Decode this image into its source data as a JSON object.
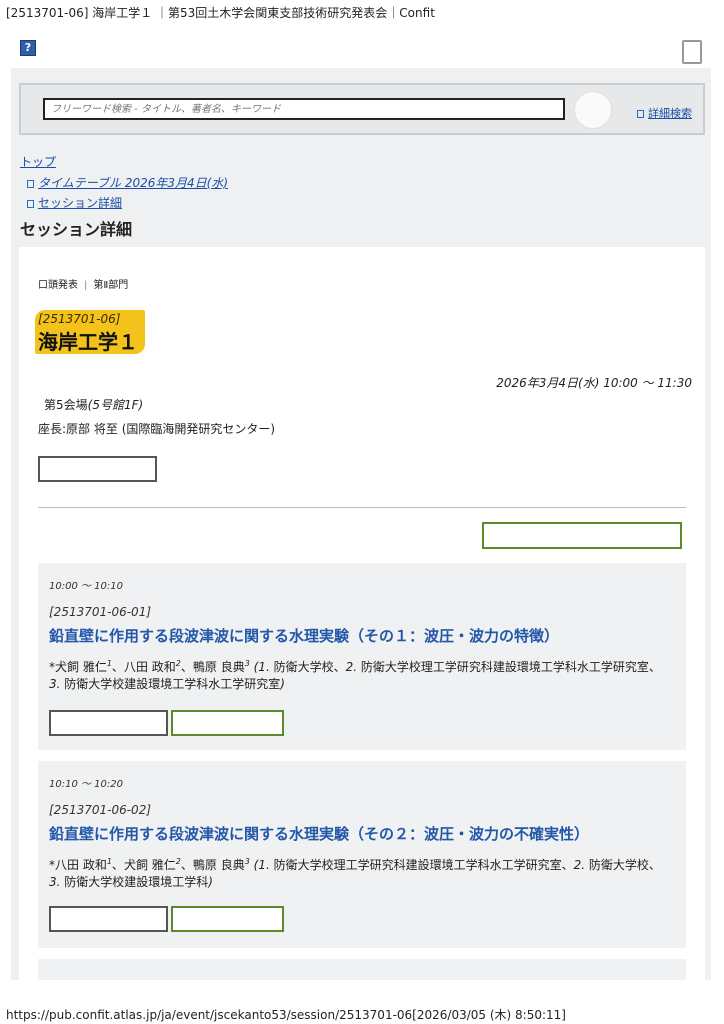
{
  "print_header": "[2513701-06] 海岸工学１ ｜第53回土木学会関東支部技術研究発表会｜Confit",
  "print_footer": "https://pub.confit.atlas.jp/ja/event/jscekanto53/session/2513701-06[2026/03/05 (木) 8:50:11]",
  "help_icon_label": "?",
  "search": {
    "placeholder": "フリーワード検索 - タイトル、著者名、キーワード",
    "advanced_label": "詳細検索"
  },
  "breadcrumb": {
    "top": "トップ",
    "timetable": "タイムテーブル 2026年3月4日(水)",
    "session": "セッション詳細"
  },
  "page_title": "セッション詳細",
  "session": {
    "type": "口頭発表",
    "division": "第Ⅱ部門",
    "id": "[2513701-06]",
    "title": "海岸工学１",
    "datetime": "2026年3月4日(水) 10:00 〜 11:30",
    "venue_room": "第5会場",
    "venue_building": "(5号館1F)",
    "chair_label": "座長:",
    "chair_name": "原部 将至",
    "chair_affil": "(国際臨海開発研究センター)"
  },
  "papers": [
    {
      "time": "10:00 〜 10:10",
      "id": "[2513701-06-01]",
      "title": "鉛直壁に作用する段波津波に関する水理実験（その１：波圧・波力の特徴）",
      "authors_line": "*犬飼 雅仁1、八田 政和2、鴨原 良典3",
      "a1": "*犬飼 雅仁",
      "s1": "1",
      "a2": "八田 政和",
      "s2": "2",
      "a3": "鴨原 良典",
      "s3": "3",
      "affil1_num": "(1.",
      "affil1": "防衛大学校、",
      "affil2_num": "2.",
      "affil2": "防衛大学校理工学研究科建設環境工学科水工学研究室、",
      "affil3_num": "3.",
      "affil3": "防衛大学校建設環境工学科水工学研究室",
      "affil_close": ")"
    },
    {
      "time": "10:10 〜 10:20",
      "id": "[2513701-06-02]",
      "title": "鉛直壁に作用する段波津波に関する水理実験（その２：波圧・波力の不確実性）",
      "a1": "*八田 政和",
      "s1": "1",
      "a2": "犬飼 雅仁",
      "s2": "2",
      "a3": "鴨原 良典",
      "s3": "3",
      "affil1_num": "(1.",
      "affil1": "防衛大学校理工学研究科建設環境工学科水工学研究室、",
      "affil2_num": "2.",
      "affil2": "防衛大学校、",
      "affil3_num": "3.",
      "affil3": "防衛大学校建設環境工学科",
      "affil_close": ")"
    }
  ]
}
